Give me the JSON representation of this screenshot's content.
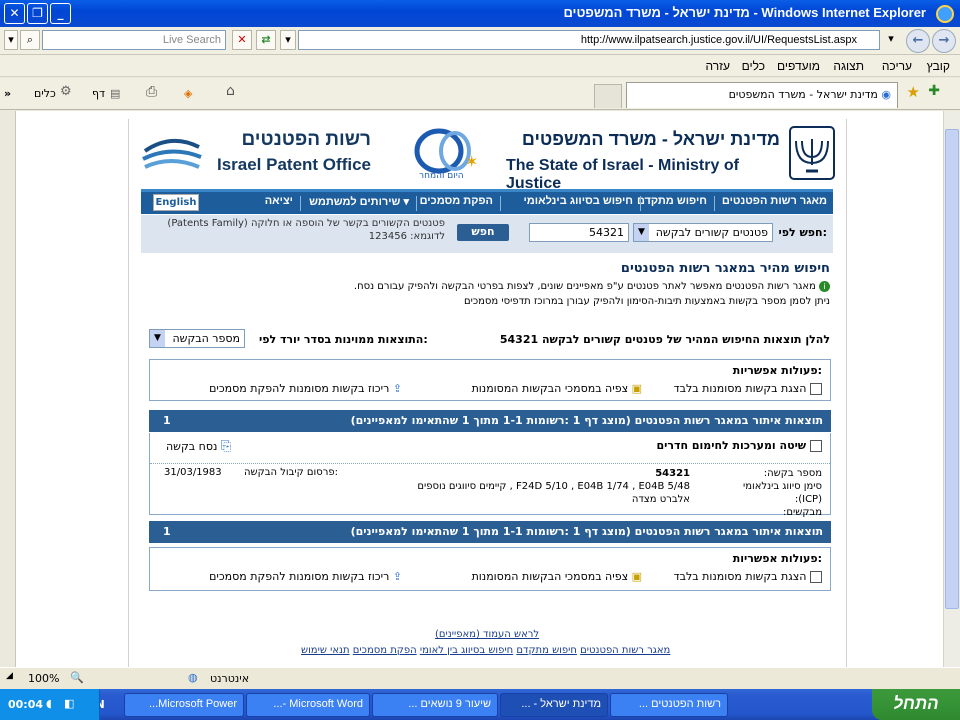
{
  "window": {
    "title": "Windows Internet Explorer - מדינת ישראל - משרד המשפטים",
    "min": "_",
    "max": "❐",
    "close": "✕"
  },
  "addressbar": {
    "url": "http://www.ilpatsearch.justice.gov.il/UI/RequestsList.aspx",
    "live_search_placeholder": "Live Search"
  },
  "menu": {
    "items": [
      "קובץ",
      "עריכה",
      "תצוגה",
      "מועדפים",
      "כלים",
      "עזרה"
    ]
  },
  "tabs": {
    "active_label": "מדינת ישראל - משרד המשפטים"
  },
  "toolbar": {
    "page": "דף",
    "tools": "כלים",
    "more": "»"
  },
  "header": {
    "ipo_heb": "רשות הפטנטים",
    "ipo_eng": "Israel Patent Office",
    "moj_heb": "מדינת ישראל - משרד המשפטים",
    "moj_eng": "The State of Israel - Ministry of Justice",
    "anniv_text": "היום והמחר"
  },
  "nav": {
    "items": [
      "מאגר רשות הפטנטים",
      "חיפוש מתקדם",
      "חיפוש בסיווג בינלאומי",
      "הפקת מסמכים",
      "שירותים למשתמש ▾",
      "יציאה"
    ],
    "english": "English"
  },
  "search": {
    "label": "חפש לפי:",
    "select_value": "פטנטים קשורים לבקשה",
    "input_value": "54321",
    "button": "חפש",
    "hint_line1": "פטנטים הקשורים בקשר של הוספה או חלוקה (Patents Family)",
    "hint_line2": "לדוגמא: 123456"
  },
  "quick": {
    "title": "חיפוש מהיר במאגר רשות הפטנטים",
    "info1": "מאגר רשות הפטנטים מאפשר לאתר פטנטים ע\"פ מאפיינים שונים, לצפות בפרטי הבקשה ולהפיק עבורם נסח.",
    "info2": "ניתן לסמן מספר בקשות באמצעות תיבות-הסימון ולהפיק עבורן במרוכז תדפיסי מסמכים"
  },
  "results_header": {
    "text": "להלן תוצאות החיפוש המהיר של פטנטים קשורים לבקשה",
    "number": "54321",
    "sort_label": "התוצאות ממוינות בסדר יורד לפי:",
    "sort_value": "מספר הבקשה"
  },
  "options": {
    "title": "פעולות אפשריות:",
    "show_marked": "הצגת בקשות מסומנות בלבד",
    "view_docs": "צפיה במסמכי הבקשות המסומנות",
    "gather_docs": "ריכוז בקשות מסומנות להפקת מסמכים"
  },
  "results_bar": {
    "text": "תוצאות איתור במאגר רשות הפטנטים (מוצג דף 1 :רשומות 1-1 מתוך 1 שהתאימו למאפיינים)",
    "page": "1"
  },
  "record": {
    "title": "שיטה ומערכות לחימום חדרים",
    "nesach": "נסח בקשה",
    "app_no_label": "מספר בקשה:",
    "app_no": "54321",
    "icp_label": "סימן סיווג בינלאומי (ICP):",
    "icp": "F24D 5/10 , E04B 1/74 , E04B 5/48 , קיימים סיווגים נוספים",
    "applicants_label": "מבקשים:",
    "applicant": "אלברט מצדה",
    "pub_label": "פרסום קיבול הבקשה:",
    "pub_date": "31/03/1983"
  },
  "footer": {
    "top_link": "לראש העמוד (מאפיינים)",
    "links": [
      "מאגר רשות הפטנטים",
      "חיפוש מתקדם",
      "חיפוש בסיווג בין לאומי",
      "הפקת מסמכים",
      "תנאי שימוש"
    ]
  },
  "status": {
    "zone": "אינטרנט",
    "zoom": "100%"
  },
  "taskbar": {
    "start": "התחל",
    "buttons": [
      "רשות הפטנטים ...",
      "מדינת ישראל - ...",
      "שיעור 9 נושאים ...",
      "Microsoft Word -...",
      "Microsoft Power..."
    ],
    "lang": "EN",
    "clock": "00:04"
  }
}
